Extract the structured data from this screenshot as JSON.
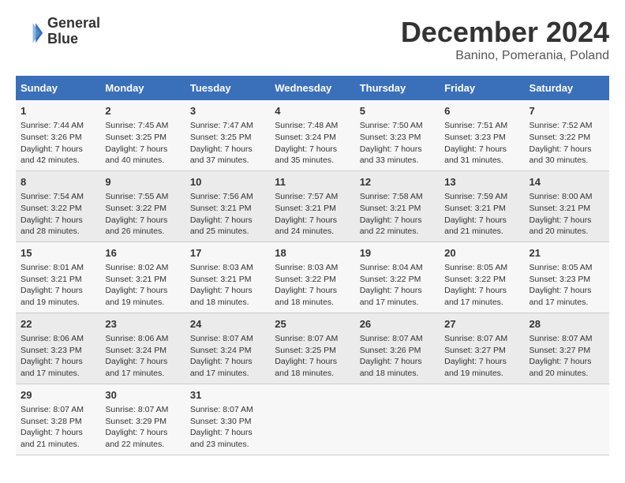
{
  "header": {
    "logo_line1": "General",
    "logo_line2": "Blue",
    "title": "December 2024",
    "subtitle": "Banino, Pomerania, Poland"
  },
  "columns": [
    "Sunday",
    "Monday",
    "Tuesday",
    "Wednesday",
    "Thursday",
    "Friday",
    "Saturday"
  ],
  "weeks": [
    [
      {
        "day": "1",
        "sunrise": "Sunrise: 7:44 AM",
        "sunset": "Sunset: 3:26 PM",
        "daylight": "Daylight: 7 hours and 42 minutes."
      },
      {
        "day": "2",
        "sunrise": "Sunrise: 7:45 AM",
        "sunset": "Sunset: 3:25 PM",
        "daylight": "Daylight: 7 hours and 40 minutes."
      },
      {
        "day": "3",
        "sunrise": "Sunrise: 7:47 AM",
        "sunset": "Sunset: 3:25 PM",
        "daylight": "Daylight: 7 hours and 37 minutes."
      },
      {
        "day": "4",
        "sunrise": "Sunrise: 7:48 AM",
        "sunset": "Sunset: 3:24 PM",
        "daylight": "Daylight: 7 hours and 35 minutes."
      },
      {
        "day": "5",
        "sunrise": "Sunrise: 7:50 AM",
        "sunset": "Sunset: 3:23 PM",
        "daylight": "Daylight: 7 hours and 33 minutes."
      },
      {
        "day": "6",
        "sunrise": "Sunrise: 7:51 AM",
        "sunset": "Sunset: 3:23 PM",
        "daylight": "Daylight: 7 hours and 31 minutes."
      },
      {
        "day": "7",
        "sunrise": "Sunrise: 7:52 AM",
        "sunset": "Sunset: 3:22 PM",
        "daylight": "Daylight: 7 hours and 30 minutes."
      }
    ],
    [
      {
        "day": "8",
        "sunrise": "Sunrise: 7:54 AM",
        "sunset": "Sunset: 3:22 PM",
        "daylight": "Daylight: 7 hours and 28 minutes."
      },
      {
        "day": "9",
        "sunrise": "Sunrise: 7:55 AM",
        "sunset": "Sunset: 3:22 PM",
        "daylight": "Daylight: 7 hours and 26 minutes."
      },
      {
        "day": "10",
        "sunrise": "Sunrise: 7:56 AM",
        "sunset": "Sunset: 3:21 PM",
        "daylight": "Daylight: 7 hours and 25 minutes."
      },
      {
        "day": "11",
        "sunrise": "Sunrise: 7:57 AM",
        "sunset": "Sunset: 3:21 PM",
        "daylight": "Daylight: 7 hours and 24 minutes."
      },
      {
        "day": "12",
        "sunrise": "Sunrise: 7:58 AM",
        "sunset": "Sunset: 3:21 PM",
        "daylight": "Daylight: 7 hours and 22 minutes."
      },
      {
        "day": "13",
        "sunrise": "Sunrise: 7:59 AM",
        "sunset": "Sunset: 3:21 PM",
        "daylight": "Daylight: 7 hours and 21 minutes."
      },
      {
        "day": "14",
        "sunrise": "Sunrise: 8:00 AM",
        "sunset": "Sunset: 3:21 PM",
        "daylight": "Daylight: 7 hours and 20 minutes."
      }
    ],
    [
      {
        "day": "15",
        "sunrise": "Sunrise: 8:01 AM",
        "sunset": "Sunset: 3:21 PM",
        "daylight": "Daylight: 7 hours and 19 minutes."
      },
      {
        "day": "16",
        "sunrise": "Sunrise: 8:02 AM",
        "sunset": "Sunset: 3:21 PM",
        "daylight": "Daylight: 7 hours and 19 minutes."
      },
      {
        "day": "17",
        "sunrise": "Sunrise: 8:03 AM",
        "sunset": "Sunset: 3:21 PM",
        "daylight": "Daylight: 7 hours and 18 minutes."
      },
      {
        "day": "18",
        "sunrise": "Sunrise: 8:03 AM",
        "sunset": "Sunset: 3:22 PM",
        "daylight": "Daylight: 7 hours and 18 minutes."
      },
      {
        "day": "19",
        "sunrise": "Sunrise: 8:04 AM",
        "sunset": "Sunset: 3:22 PM",
        "daylight": "Daylight: 7 hours and 17 minutes."
      },
      {
        "day": "20",
        "sunrise": "Sunrise: 8:05 AM",
        "sunset": "Sunset: 3:22 PM",
        "daylight": "Daylight: 7 hours and 17 minutes."
      },
      {
        "day": "21",
        "sunrise": "Sunrise: 8:05 AM",
        "sunset": "Sunset: 3:23 PM",
        "daylight": "Daylight: 7 hours and 17 minutes."
      }
    ],
    [
      {
        "day": "22",
        "sunrise": "Sunrise: 8:06 AM",
        "sunset": "Sunset: 3:23 PM",
        "daylight": "Daylight: 7 hours and 17 minutes."
      },
      {
        "day": "23",
        "sunrise": "Sunrise: 8:06 AM",
        "sunset": "Sunset: 3:24 PM",
        "daylight": "Daylight: 7 hours and 17 minutes."
      },
      {
        "day": "24",
        "sunrise": "Sunrise: 8:07 AM",
        "sunset": "Sunset: 3:24 PM",
        "daylight": "Daylight: 7 hours and 17 minutes."
      },
      {
        "day": "25",
        "sunrise": "Sunrise: 8:07 AM",
        "sunset": "Sunset: 3:25 PM",
        "daylight": "Daylight: 7 hours and 18 minutes."
      },
      {
        "day": "26",
        "sunrise": "Sunrise: 8:07 AM",
        "sunset": "Sunset: 3:26 PM",
        "daylight": "Daylight: 7 hours and 18 minutes."
      },
      {
        "day": "27",
        "sunrise": "Sunrise: 8:07 AM",
        "sunset": "Sunset: 3:27 PM",
        "daylight": "Daylight: 7 hours and 19 minutes."
      },
      {
        "day": "28",
        "sunrise": "Sunrise: 8:07 AM",
        "sunset": "Sunset: 3:27 PM",
        "daylight": "Daylight: 7 hours and 20 minutes."
      }
    ],
    [
      {
        "day": "29",
        "sunrise": "Sunrise: 8:07 AM",
        "sunset": "Sunset: 3:28 PM",
        "daylight": "Daylight: 7 hours and 21 minutes."
      },
      {
        "day": "30",
        "sunrise": "Sunrise: 8:07 AM",
        "sunset": "Sunset: 3:29 PM",
        "daylight": "Daylight: 7 hours and 22 minutes."
      },
      {
        "day": "31",
        "sunrise": "Sunrise: 8:07 AM",
        "sunset": "Sunset: 3:30 PM",
        "daylight": "Daylight: 7 hours and 23 minutes."
      },
      null,
      null,
      null,
      null
    ]
  ]
}
